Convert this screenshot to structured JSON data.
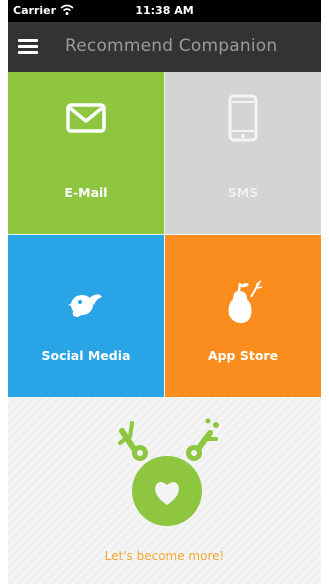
{
  "status_bar": {
    "carrier": "Carrier",
    "time": "11:38 AM"
  },
  "nav": {
    "title": "Recommend Companion",
    "menu_icon": "hamburger-menu-icon"
  },
  "tiles": [
    {
      "label": "E-Mail",
      "icon": "envelope-icon",
      "color": "#8ec63f"
    },
    {
      "label": "SMS",
      "icon": "smartphone-icon",
      "color": "#d4d4d4"
    },
    {
      "label": "Social Media",
      "icon": "twitter-bird-icon",
      "color": "#29a4e6"
    },
    {
      "label": "App Store",
      "icon": "pear-icon",
      "color": "#fb8c1e"
    }
  ],
  "promo": {
    "text": "Let's become more!",
    "accent": "#8ec63f",
    "text_color": "#f2a830"
  }
}
